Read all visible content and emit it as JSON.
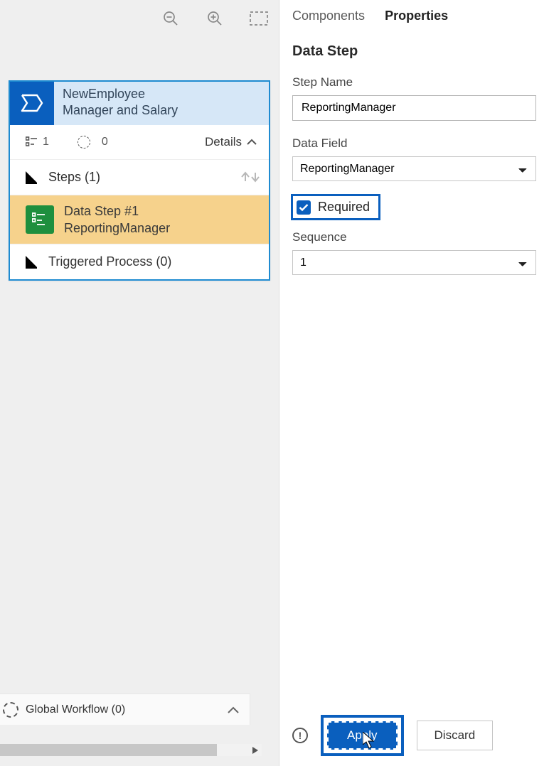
{
  "tabs": {
    "components": "Components",
    "properties": "Properties"
  },
  "panel": {
    "title": "Data Step",
    "step_name_label": "Step Name",
    "step_name_value": "ReportingManager",
    "data_field_label": "Data Field",
    "data_field_value": "ReportingManager",
    "required_label": "Required",
    "sequence_label": "Sequence",
    "sequence_value": "1",
    "apply_label": "Apply",
    "discard_label": "Discard"
  },
  "stage": {
    "line1": "NewEmployee",
    "line2": "Manager and Salary",
    "count1": "1",
    "count2": "0",
    "details_label": "Details",
    "steps_label": "Steps (1)",
    "data_step_line1": "Data Step #1",
    "data_step_line2": "ReportingManager",
    "triggered_label": "Triggered Process (0)"
  },
  "global_bar": {
    "label": "Global Workflow (0)"
  }
}
